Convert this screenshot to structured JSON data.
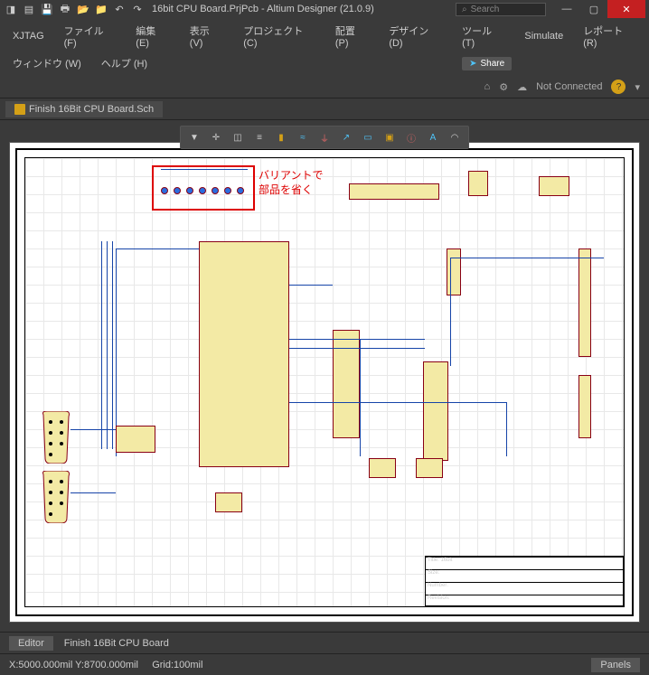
{
  "titlebar": {
    "app_title": "16bit CPU Board.PrjPcb - Altium Designer (21.0.9)",
    "search_placeholder": "Search",
    "icons": [
      "file-icon",
      "save-icon",
      "print-icon",
      "open-icon",
      "open-folder-icon",
      "undo-icon",
      "redo-icon"
    ]
  },
  "menu": {
    "row1": [
      "XJTAG",
      "ファイル (F)",
      "編集 (E)",
      "表示 (V)",
      "プロジェクト (C)",
      "配置 (P)",
      "デザイン (D)",
      "ツール (T)",
      "Simulate",
      "レポート (R)"
    ],
    "row2": [
      "ウィンドウ (W)",
      "ヘルプ (H)"
    ],
    "share": "Share"
  },
  "topright": {
    "home": "⌂",
    "settings": "⚙",
    "cloud": "☁",
    "status": "Not Connected",
    "badge": "?"
  },
  "tab": {
    "label": "Finish 16Bit CPU Board.Sch"
  },
  "toolbar": {
    "tools": [
      "filter-icon",
      "zoom-fit-icon",
      "select-icon",
      "align-icon",
      "net-color-icon",
      "wave-icon",
      "ground-icon",
      "probe-icon",
      "component-icon",
      "directive-icon",
      "text-icon",
      "font-icon",
      "arc-icon"
    ]
  },
  "schematic": {
    "annotation1": "バリアントで",
    "annotation2": "部品を省く",
    "title_block": {
      "title": "Title: 16bit",
      "size": "Size:",
      "number": "Number:",
      "revision": "Revision:"
    }
  },
  "statusbar1": {
    "editor": "Editor",
    "file": "Finish 16Bit CPU Board"
  },
  "statusbar2": {
    "coords": "X:5000.000mil Y:8700.000mil",
    "grid": "Grid:100mil",
    "panels": "Panels"
  }
}
